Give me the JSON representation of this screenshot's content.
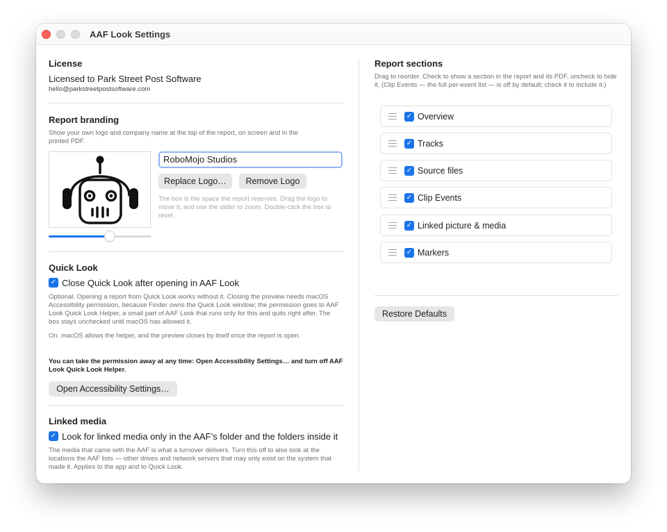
{
  "window": {
    "title": "AAF Look Settings"
  },
  "license": {
    "heading": "License",
    "licensee": "Licensed to Park Street Post Software",
    "email": "hello@parkstreetpostsoftware.com"
  },
  "branding": {
    "heading": "Report branding",
    "description": "Show your own logo and company name at the top of the report, on screen and in the printed PDF.",
    "company_name_value": "RoboMojo Studios",
    "replace_logo_label": "Replace Logo…",
    "remove_logo_label": "Remove Logo",
    "hint": "The box is the space the report reserves. Drag the logo to move it, and use the slider to zoom. Double-click the box to reset.",
    "zoom_fraction": 0.6
  },
  "quick_look": {
    "heading": "Quick Look",
    "checkbox_label": "Close Quick Look after opening in AAF Look",
    "checked": true,
    "explanation": "Optional. Opening a report from Quick Look works without it. Closing the preview needs macOS Accessibility permission, because Finder owns the Quick Look window; the permission goes to AAF Look Quick Look Helper, a small part of AAF Look that runs only for this and quits right after. The box stays unchecked until macOS has allowed it.",
    "status": "On. macOS allows the helper, and the preview closes by itself once the report is open.",
    "permission_note": "You can take the permission away at any time: Open Accessibility Settings… and turn off AAF Look Quick Look Helper.",
    "open_settings_label": "Open Accessibility Settings…"
  },
  "linked_media": {
    "heading": "Linked media",
    "checkbox_label": "Look for linked media only in the AAF’s folder and the folders inside it",
    "checked": true,
    "explanation": "The media that came with the AAF is what a turnover delivers. Turn this off to also look at the locations the AAF lists — other drives and network servers that may only exist on the system that made it. Applies to the app and to Quick Look."
  },
  "report_sections": {
    "heading": "Report sections",
    "description": "Drag to reorder. Check to show a section in the report and its PDF, uncheck to hide it. (Clip Events — the full per-event list — is off by default; check it to include it.)",
    "items": [
      {
        "label": "Overview",
        "checked": true
      },
      {
        "label": "Tracks",
        "checked": true
      },
      {
        "label": "Source files",
        "checked": true
      },
      {
        "label": "Clip Events",
        "checked": true
      },
      {
        "label": "Linked picture & media",
        "checked": true
      },
      {
        "label": "Markers",
        "checked": true
      }
    ],
    "restore_defaults_label": "Restore Defaults"
  },
  "check_glyph": "✓",
  "colors": {
    "accent": "#1a73e8",
    "close": "#ff5f57"
  }
}
